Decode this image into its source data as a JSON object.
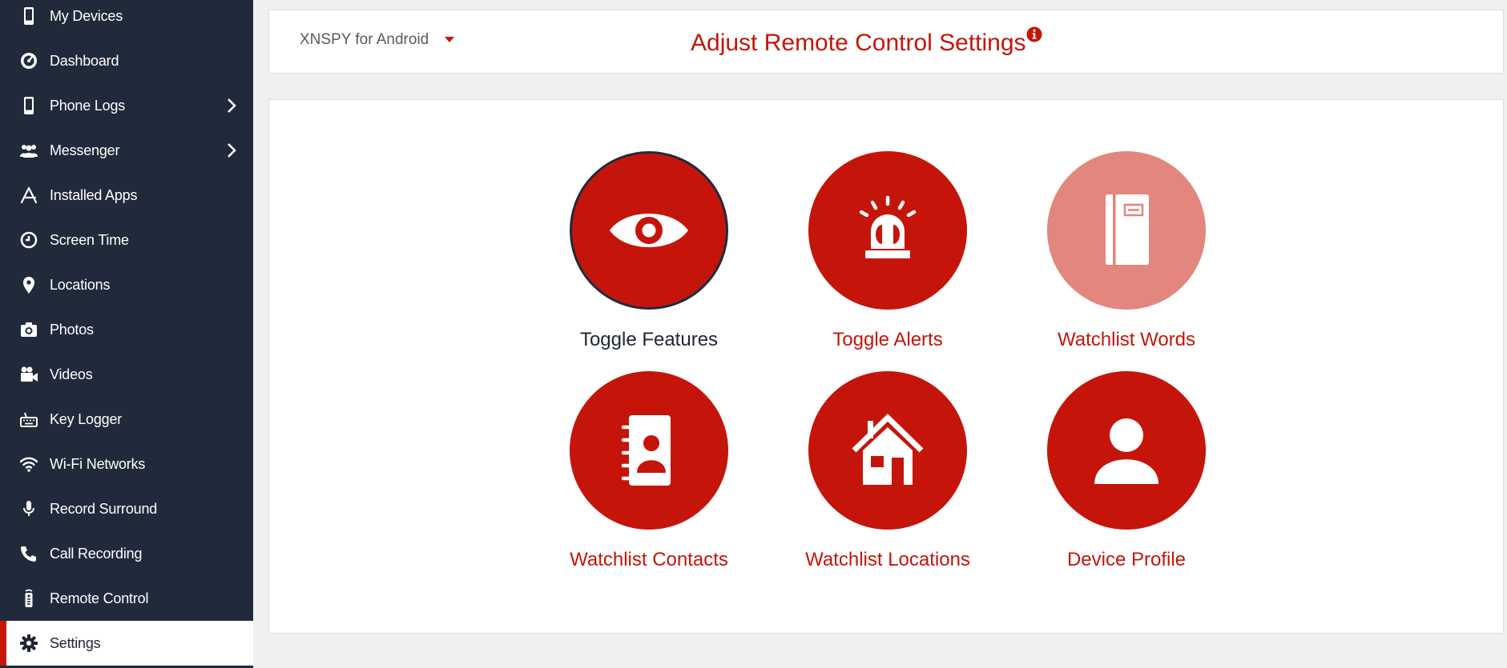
{
  "sidebar": {
    "items": [
      {
        "label": "My Devices",
        "icon": "phone-icon",
        "has_submenu": false
      },
      {
        "label": "Dashboard",
        "icon": "gauge-icon",
        "has_submenu": false
      },
      {
        "label": "Phone Logs",
        "icon": "phone-icon",
        "has_submenu": true
      },
      {
        "label": "Messenger",
        "icon": "users-icon",
        "has_submenu": true
      },
      {
        "label": "Installed Apps",
        "icon": "app-store-icon",
        "has_submenu": false
      },
      {
        "label": "Screen Time",
        "icon": "clock-icon",
        "has_submenu": false
      },
      {
        "label": "Locations",
        "icon": "map-pin-icon",
        "has_submenu": false
      },
      {
        "label": "Photos",
        "icon": "camera-icon",
        "has_submenu": false
      },
      {
        "label": "Videos",
        "icon": "video-camera-icon",
        "has_submenu": false
      },
      {
        "label": "Key Logger",
        "icon": "keyboard-icon",
        "has_submenu": false
      },
      {
        "label": "Wi-Fi Networks",
        "icon": "wifi-icon",
        "has_submenu": false
      },
      {
        "label": "Record Surround",
        "icon": "microphone-icon",
        "has_submenu": false
      },
      {
        "label": "Call Recording",
        "icon": "phone-handset-icon",
        "has_submenu": false
      },
      {
        "label": "Remote Control",
        "icon": "remote-icon",
        "has_submenu": false
      },
      {
        "label": "Settings",
        "icon": "gear-icon",
        "has_submenu": false,
        "active": true
      }
    ]
  },
  "header": {
    "device_label": "XNSPY for Android",
    "title": "Adjust Remote Control Settings"
  },
  "tiles": [
    {
      "label": "Toggle Features",
      "icon": "eye-icon",
      "state": "selected"
    },
    {
      "label": "Toggle Alerts",
      "icon": "alarm-siren-icon",
      "state": "normal"
    },
    {
      "label": "Watchlist Words",
      "icon": "notebook-icon",
      "state": "muted"
    },
    {
      "label": "Watchlist Contacts",
      "icon": "address-book-icon",
      "state": "normal"
    },
    {
      "label": "Watchlist Locations",
      "icon": "house-icon",
      "state": "normal"
    },
    {
      "label": "Device Profile",
      "icon": "user-icon",
      "state": "normal"
    }
  ],
  "colors": {
    "accent": "#c5150a",
    "accent_muted": "#e2867e",
    "sidebar_bg": "#212a3a",
    "page_bg": "#f0f0f0"
  }
}
